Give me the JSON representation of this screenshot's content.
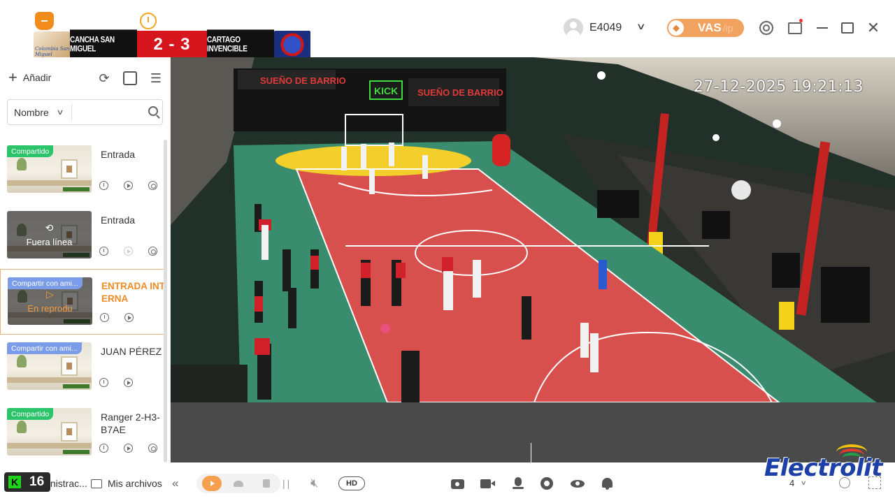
{
  "titlebar": {
    "user_name": "E4049",
    "vas_label": "VAS",
    "vas_suffix": "/ip",
    "close_symbol": "✕"
  },
  "scoreboard": {
    "team_left": "CANCHA SAN MIGUEL",
    "team_right": "CARTAGO INVENCIBLE",
    "score": "2 - 3",
    "logo_left_text": "Colombia San Miguel"
  },
  "sidebar": {
    "add_label": "Añadir",
    "filter_label": "Nombre",
    "search_placeholder": "",
    "cameras": [
      {
        "name": "Entrada",
        "tag": "Compartido",
        "tag_color": "#2cc46b",
        "status": ""
      },
      {
        "name": "Entrada",
        "tag": "",
        "tag_color": "",
        "status": "Fuera línea"
      },
      {
        "name": "ENTRADA INTERNA",
        "tag": "Compartir con ami...",
        "tag_color": "#7b9ce8",
        "status": "En reprodu"
      },
      {
        "name": "JUAN PÉREZ",
        "tag": "Compartir con ami...",
        "tag_color": "#7b9ce8",
        "status": ""
      },
      {
        "name": "Ranger 2-H3-B7AE",
        "tag": "Compartido",
        "tag_color": "#2cc46b",
        "status": ""
      }
    ],
    "admin_label": "Administrac...",
    "files_label": "Mis archivos"
  },
  "video": {
    "timestamp": "27-12-2025 19:21:13",
    "banner_text": "SUEÑO DE BARRIO",
    "banner_sub": "KICK"
  },
  "toolbar": {
    "hd_label": "HD",
    "grid_count": "4"
  },
  "overlay": {
    "k_number": "16",
    "sponsor": "Electrolit"
  },
  "colors": {
    "accent": "#f28c1a",
    "score_red": "#d6151c",
    "sponsor_blue": "#1d3fa8"
  }
}
